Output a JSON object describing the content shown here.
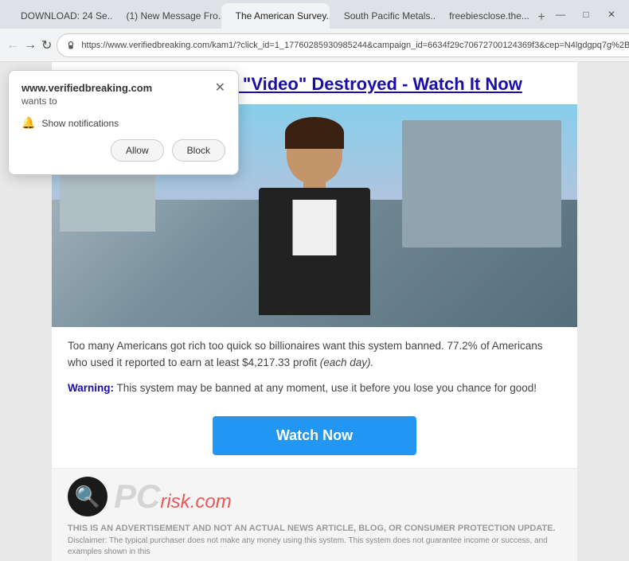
{
  "browser": {
    "tabs": [
      {
        "id": "tab1",
        "label": "DOWNLOAD: 24 Se...",
        "favicon": "download",
        "active": false
      },
      {
        "id": "tab2",
        "label": "(1) New Message Fro...",
        "favicon": "mail",
        "active": false
      },
      {
        "id": "tab3",
        "label": "The American Survey...",
        "favicon": "survey",
        "active": true
      },
      {
        "id": "tab4",
        "label": "South Pacific Metals...",
        "favicon": "metal",
        "active": false
      },
      {
        "id": "tab5",
        "label": "freebiesclose.the...",
        "favicon": "free",
        "active": false
      }
    ],
    "url": "https://www.verifiedbreaking.com/kam1/?click_id=1_17760285930985244&campaign_id=6634f29c70672700124369f3&cep=N4lgdgpq7g%2B8..."
  },
  "notification": {
    "site": "www.verifiedbreaking.com",
    "wants_label": "wants to",
    "show_notifications": "Show notifications",
    "allow_btn": "Allow",
    "block_btn": "Block"
  },
  "page": {
    "headline": "Vant This Weird \"Video\" Destroyed - Watch It Now",
    "body_text1": "Too many Americans got rich too quick so billionaires want this system banned. 77.2% of Americans who used it reported to earn at least $4,217.33 profit ",
    "body_text1_italic": "(each day).",
    "warning_label": "Warning:",
    "warning_text": " This system may be banned at any moment, use it before you lose you chance for good!",
    "watch_btn": "Watch Now",
    "footer": {
      "logo_text": "PC",
      "logo_com": "risk.com",
      "disclaimer_title": "THIS IS AN ADVERTISEMENT AND NOT AN ACTUAL NEWS ARTICLE, BLOG, OR CONSUMER PROTECTION UPDATE.",
      "disclaimer_text": "Disclaimer: The typical purchaser does not make any money using this system. This system does not guarantee income or success, and examples shown in this"
    }
  }
}
